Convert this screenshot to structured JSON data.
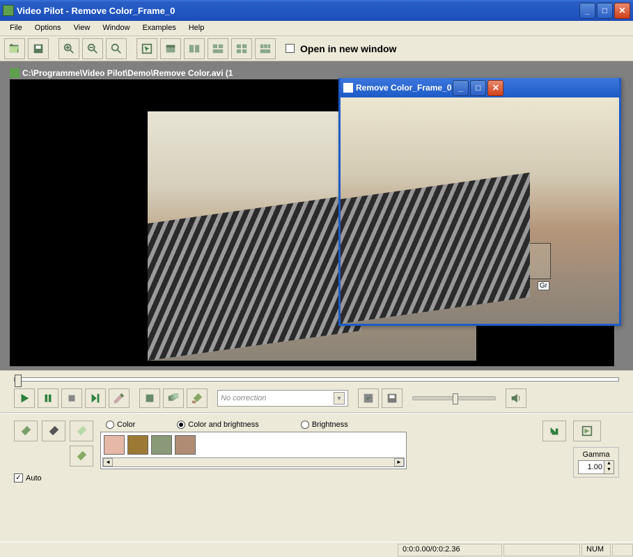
{
  "title": "Video Pilot - Remove Color_Frame_0",
  "menu": [
    "File",
    "Options",
    "View",
    "Window",
    "Examples",
    "Help"
  ],
  "toolbar": {
    "open_new_label": "Open in new window"
  },
  "doc_path": "C:\\Programme\\Video Pilot\\Demo\\Remove Color.avi (1",
  "combo": {
    "text": "No correction"
  },
  "modes": {
    "color": "Color",
    "color_bright": "Color and brightness",
    "bright": "Brightness"
  },
  "auto_label": "Auto",
  "gamma": {
    "label": "Gamma",
    "value": "1.00"
  },
  "status": {
    "time": "0:0:0.00/0:0:2.36",
    "num": "NUM"
  },
  "child": {
    "title": "Remove Color_Frame_0",
    "sel_label": "Gr"
  },
  "swatches": [
    "#e6b8a8",
    "#9c7a34",
    "#8a9a78",
    "#b08c74"
  ]
}
